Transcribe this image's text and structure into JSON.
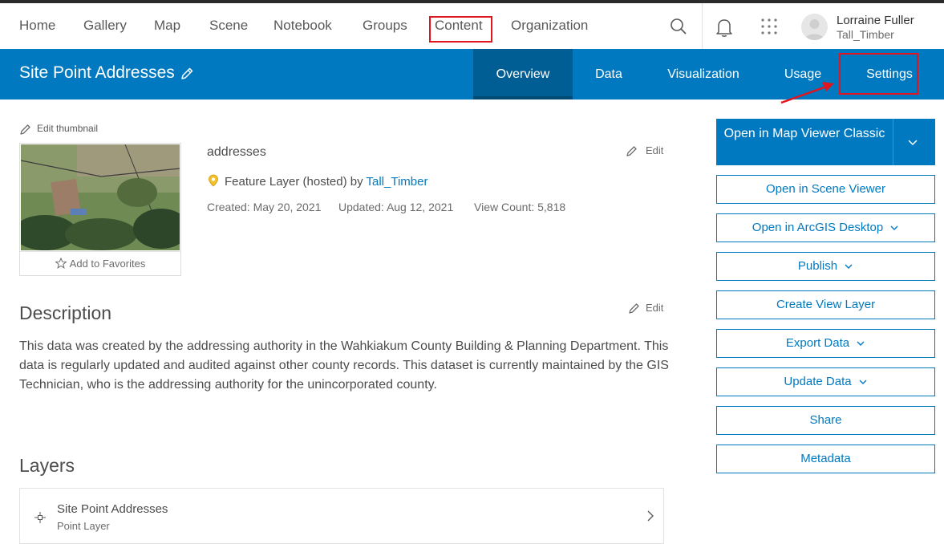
{
  "topnav": {
    "links": [
      "Home",
      "Gallery",
      "Map",
      "Scene",
      "Notebook",
      "Groups",
      "Content",
      "Organization"
    ],
    "user_name": "Lorraine Fuller",
    "user_handle": "Tall_Timber"
  },
  "titlebar": {
    "title": "Site Point Addresses",
    "tabs": [
      "Overview",
      "Data",
      "Visualization",
      "Usage",
      "Settings"
    ]
  },
  "item": {
    "edit_thumbnail": "Edit thumbnail",
    "add_favorites": "Add to Favorites",
    "name": "addresses",
    "edit_label": "Edit",
    "type_prefix": "Feature Layer (hosted) by",
    "owner": "Tall_Timber",
    "created": "Created: May 20, 2021",
    "updated": "Updated: Aug 12, 2021",
    "view_count": "View Count: 5,818"
  },
  "description": {
    "heading": "Description",
    "edit_label": "Edit",
    "text": "This data was created by the addressing authority in the Wahkiakum County Building & Planning Department. This data is regularly updated and audited against other county records. This dataset is currently maintained by the GIS Technician, who is the addressing authority for the unincorporated county."
  },
  "layers": {
    "heading": "Layers",
    "items": [
      {
        "name": "Site Point Addresses",
        "type": "Point Layer"
      }
    ]
  },
  "actions": {
    "primary": "Open in Map Viewer Classic",
    "buttons": [
      "Open in Scene Viewer",
      "Open in ArcGIS Desktop",
      "Publish",
      "Create View Layer",
      "Export Data",
      "Update Data",
      "Share",
      "Metadata"
    ]
  },
  "colors": {
    "brand_blue": "#0079c1",
    "active_tab": "#005e95",
    "highlight_red": "#e0151f"
  },
  "icons": [
    "search-icon",
    "bell-icon",
    "apps-grid-icon",
    "pencil-icon",
    "star-icon",
    "feature-layer-icon",
    "chevron-down-icon",
    "chevron-right-icon",
    "point-layer-icon"
  ]
}
